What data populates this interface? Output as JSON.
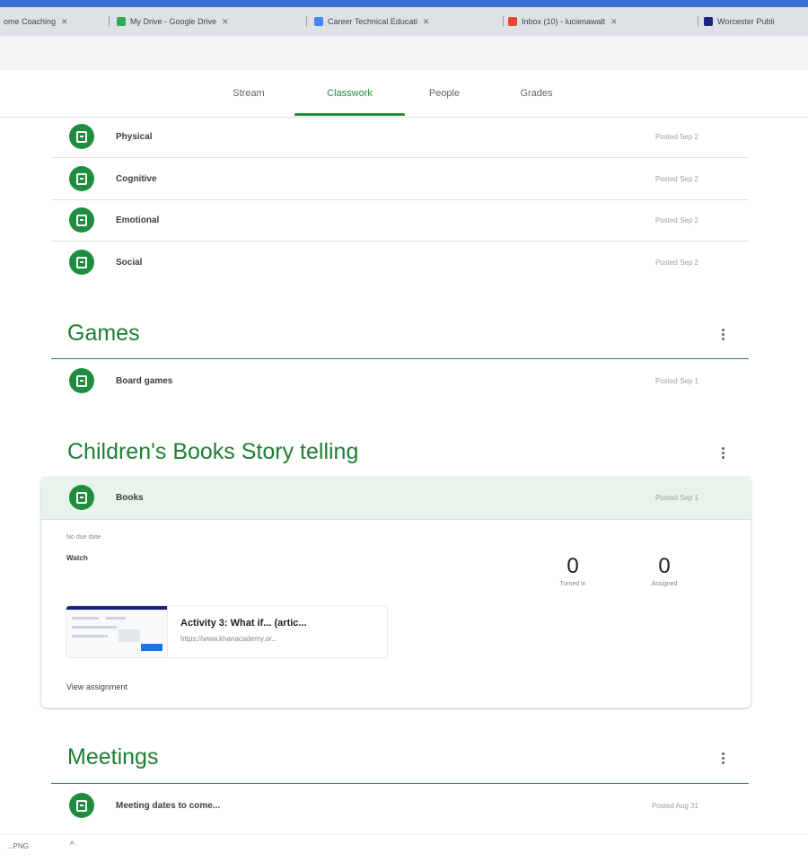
{
  "browser": {
    "tabs": [
      {
        "label": "ome Coaching",
        "icon": "classroom-icon",
        "color": "#fbbc04"
      },
      {
        "label": "My Drive - Google Drive",
        "icon": "drive-icon",
        "color": "#34a853"
      },
      {
        "label": "Career Technical Educati",
        "icon": "docs-icon",
        "color": "#4285f4"
      },
      {
        "label": "Inbox (10) - lucienawalt",
        "icon": "gmail-icon",
        "color": "#ea4335"
      },
      {
        "label": "Worcester Publi",
        "icon": "site-icon",
        "color": "#1a237e"
      }
    ]
  },
  "nav": {
    "tabs": [
      "Stream",
      "Classwork",
      "People",
      "Grades"
    ],
    "active": "Classwork"
  },
  "topic_items": [
    {
      "title": "Physical",
      "date": "Posted Sep 2"
    },
    {
      "title": "Cognitive",
      "date": "Posted Sep 2"
    },
    {
      "title": "Emotional",
      "date": "Posted Sep 2"
    },
    {
      "title": "Social",
      "date": "Posted Sep 2"
    }
  ],
  "sections": [
    {
      "title": "Games",
      "items": [
        {
          "title": "Board games",
          "date": "Posted Sep 1"
        }
      ]
    },
    {
      "title": "Children's Books Story telling",
      "items": [
        {
          "title": "Books",
          "date": "Posted Sep 1"
        }
      ]
    },
    {
      "title": "Meetings",
      "items": [
        {
          "title": "Meeting dates to come...",
          "date": "Posted Aug 31"
        }
      ]
    }
  ],
  "expanded": {
    "meta": "No due date",
    "instructions": "Watch",
    "turned_in": {
      "value": "0",
      "label": "Turned in"
    },
    "assigned": {
      "value": "0",
      "label": "Assigned"
    },
    "attachment": {
      "title": "Activity 3: What if... (artic...",
      "url": "https://www.khanacademy.or..."
    },
    "view_link": "View assignment"
  },
  "download": {
    "filename": "...PNG",
    "chevron": "^"
  },
  "colors": {
    "accent": "#1e8e3e",
    "section_title": "#1e7e34",
    "highlight": "#e6f4ea"
  }
}
